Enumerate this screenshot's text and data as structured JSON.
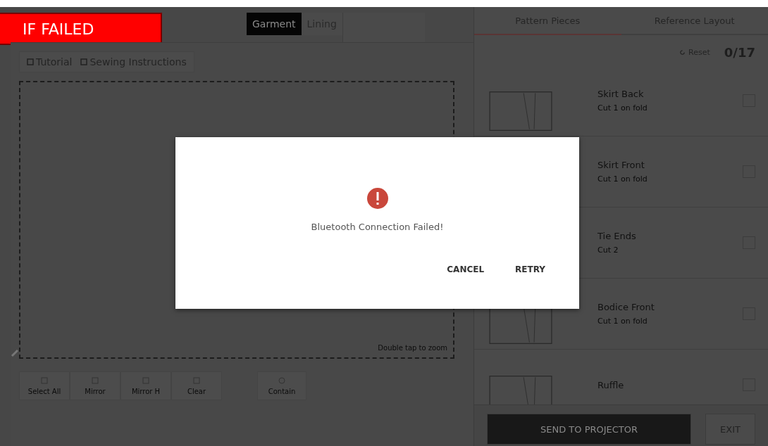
{
  "banner": {
    "text": "IF FAILED"
  },
  "fabric_tabs": [
    {
      "label": "Garment",
      "selected": true
    },
    {
      "label": "Lining",
      "selected": false
    }
  ],
  "tool_buttons": [
    "Tutorial",
    "Sewing Instructions"
  ],
  "canvas": {
    "hint": "Double tap to zoom"
  },
  "toolbar": [
    {
      "label": "Select All"
    },
    {
      "label": "Mirror"
    },
    {
      "label": "Mirror H"
    },
    {
      "label": "Clear"
    }
  ],
  "contain_button": {
    "label": "Contain"
  },
  "panel_tabs": [
    {
      "label": "Pattern Pieces",
      "selected": true
    },
    {
      "label": "Reference Layout",
      "selected": false
    }
  ],
  "reset": {
    "label": "Reset"
  },
  "progress": "0/17",
  "pieces": [
    {
      "name": "Skirt Back",
      "note": "Cut 1 on fold",
      "checked": false
    },
    {
      "name": "Skirt Front",
      "note": "Cut 1 on fold",
      "checked": false
    },
    {
      "name": "Tie Ends",
      "note": "Cut 2",
      "checked": false
    },
    {
      "name": "Bodice Front",
      "note": "Cut 1 on fold",
      "checked": false
    },
    {
      "name": "Ruffle",
      "checked": false
    }
  ],
  "footer_buttons": [
    "SEND TO PROJECTOR",
    "EXIT"
  ],
  "dialog": {
    "message": "Bluetooth Connection Failed!",
    "buttons": [
      "CANCEL",
      "RETRY"
    ]
  }
}
